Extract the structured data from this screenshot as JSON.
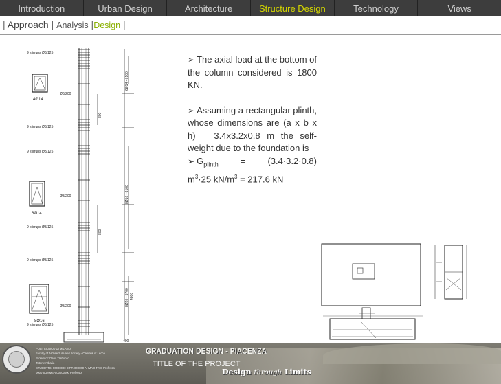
{
  "nav": {
    "tabs": [
      {
        "label": "Introduction"
      },
      {
        "label": "Urban Design"
      },
      {
        "label": "Architecture"
      },
      {
        "label": "Structure Design"
      },
      {
        "label": "Technology"
      },
      {
        "label": "Views"
      }
    ],
    "active_index": 3
  },
  "breadcrumb": {
    "prefix": "| ",
    "item1": "Approach",
    "sep1": " | ",
    "item2": "Analysis",
    "sep2": " |",
    "item3": "Design",
    "suffix": " |"
  },
  "column_drawing": {
    "stirrups_labels": [
      "9 stirrups Ø8/125",
      "9 stirrups Ø8/125",
      "9 stirrups Ø8/125",
      "9 stirrups Ø8/125",
      "9 stirrups Ø8/125",
      "9 stirrups Ø8/125"
    ],
    "spacing_labels": [
      "Ø8/200",
      "Ø8/200",
      "Ø8/200"
    ],
    "section_labels": [
      "4Ø14",
      "6Ø14",
      "8Ø16"
    ],
    "rebar_labels": [
      "6Ø14 - 6100",
      "8Ø16 - 6100",
      "8Ø20 - 5700",
      "4800"
    ],
    "dims": [
      "800",
      "800",
      "400"
    ]
  },
  "text": {
    "p1": "The axial load at the bottom of the column considered is 1800 KN.",
    "p2": "Assuming a rectangular plinth, whose dimensions are (a x b x h) = 3.4x3.2x0.8 m the self-weight due to the foundation is",
    "g_label": "G",
    "g_sub": "plinth",
    "g_eq": "=",
    "g_val": "(3.4·3.2·0.8)",
    "g_line2a": "m",
    "g_sup1": "3",
    "g_line2b": "·25 kN/m",
    "g_sup2": "3",
    "g_line2c": " = 217.6 kN"
  },
  "footer": {
    "info": [
      "POLITECNICO DI MILANO",
      "Faculty of Architecture and Society - Campus of Lecco",
      "Professor: Dario Trabucco",
      "Tutors: Arbaria",
      "STUDENTS: 00000000  DIPT.  000000  AHMAD  TRIC  Professor",
      "0000 SUMMER  00000000   Professor"
    ],
    "graduation": "GRADUATION DESIGN - PIACENZA",
    "project": "TITLE OF THE PROJECT",
    "motto_a": "Design ",
    "motto_b": "through",
    "motto_c": " Limits"
  }
}
